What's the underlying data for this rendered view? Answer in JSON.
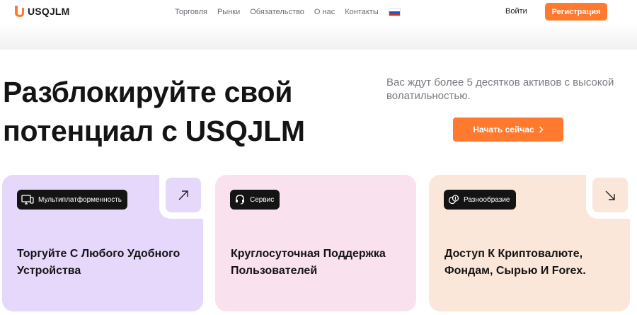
{
  "brand": {
    "name": "USQJLM",
    "accent_color": "#ff7a2f"
  },
  "nav": {
    "items": [
      {
        "label": "Торговля"
      },
      {
        "label": "Рынки"
      },
      {
        "label": "Обязательство"
      },
      {
        "label": "О нас"
      },
      {
        "label": "Контакты"
      }
    ],
    "language_icon": "russia-flag-icon"
  },
  "header": {
    "login_label": "Войти",
    "register_label": "Регистрация"
  },
  "hero": {
    "title_line1": "Разблокируйте свой",
    "title_line2": "потенциал с USQJLM",
    "subtitle": "Вас ждут более 5 десятков активов с высокой волатильностью.",
    "cta_label": "Начать сейчас",
    "cta_icon": "chevron-right-icon"
  },
  "cards": [
    {
      "badge": "Мультиплатформенность",
      "badge_icon": "monitor-icon",
      "text": "Торгуйте С Любого Удобного Устройства",
      "corner_icon": "arrow-up-right-icon",
      "color": "#e6d8fb"
    },
    {
      "badge": "Сервис",
      "badge_icon": "headset-icon",
      "text": "Круглосуточная Поддержка Пользователей",
      "color": "#fae1ee"
    },
    {
      "badge": "Разнообразие",
      "badge_icon": "coins-icon",
      "text": "Доступ К Криптовалюте, Фондам, Сырью И Forex.",
      "corner_icon": "arrow-down-right-icon",
      "color": "#fbe7da"
    }
  ]
}
